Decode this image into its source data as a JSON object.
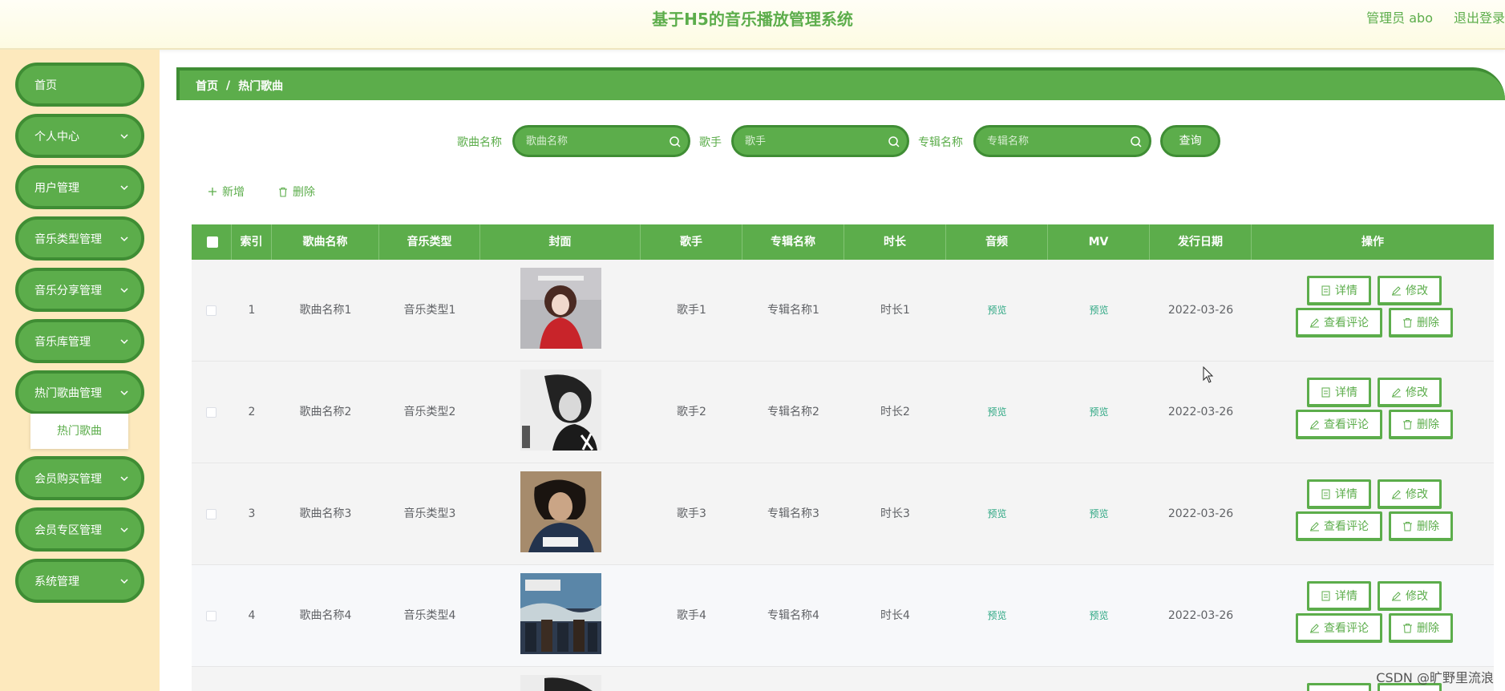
{
  "header": {
    "title": "基于H5的音乐播放管理系统",
    "user": "管理员 abo",
    "logout": "退出登录"
  },
  "sidebar": {
    "items": [
      {
        "label": "首页",
        "has_arrow": false
      },
      {
        "label": "个人中心",
        "has_arrow": true
      },
      {
        "label": "用户管理",
        "has_arrow": true
      },
      {
        "label": "音乐类型管理",
        "has_arrow": true
      },
      {
        "label": "音乐分享管理",
        "has_arrow": true
      },
      {
        "label": "音乐库管理",
        "has_arrow": true
      },
      {
        "label": "热门歌曲管理",
        "has_arrow": true
      },
      {
        "label": "会员购买管理",
        "has_arrow": true
      },
      {
        "label": "会员专区管理",
        "has_arrow": true
      },
      {
        "label": "系统管理",
        "has_arrow": true
      }
    ],
    "submenu": {
      "label": "热门歌曲"
    }
  },
  "breadcrumb": {
    "home": "首页",
    "sep": "/",
    "current": "热门歌曲"
  },
  "search": {
    "song_label": "歌曲名称",
    "song_placeholder": "歌曲名称",
    "singer_label": "歌手",
    "singer_placeholder": "歌手",
    "album_label": "专辑名称",
    "album_placeholder": "专辑名称",
    "query_label": "查询"
  },
  "actions": {
    "add_label": "新增",
    "delete_label": "删除"
  },
  "table": {
    "headers": [
      "索引",
      "歌曲名称",
      "音乐类型",
      "封面",
      "歌手",
      "专辑名称",
      "时长",
      "音频",
      "MV",
      "发行日期",
      "操作"
    ],
    "rows": [
      {
        "index": "1",
        "song": "歌曲名称1",
        "type": "音乐类型1",
        "singer": "歌手1",
        "album": "专辑名称1",
        "duration": "时长1",
        "audio": "预览",
        "mv": "预览",
        "date": "2022-03-26"
      },
      {
        "index": "2",
        "song": "歌曲名称2",
        "type": "音乐类型2",
        "singer": "歌手2",
        "album": "专辑名称2",
        "duration": "时长2",
        "audio": "预览",
        "mv": "预览",
        "date": "2022-03-26"
      },
      {
        "index": "3",
        "song": "歌曲名称3",
        "type": "音乐类型3",
        "singer": "歌手3",
        "album": "专辑名称3",
        "duration": "时长3",
        "audio": "预览",
        "mv": "预览",
        "date": "2022-03-26"
      },
      {
        "index": "4",
        "song": "歌曲名称4",
        "type": "音乐类型4",
        "singer": "歌手4",
        "album": "专辑名称4",
        "duration": "时长4",
        "audio": "预览",
        "mv": "预览",
        "date": "2022-03-26"
      }
    ],
    "row_actions": {
      "detail": "详情",
      "edit": "修改",
      "comments": "查看评论",
      "delete": "删除"
    }
  },
  "watermark": "CSDN @旷野里流浪",
  "colors": {
    "primary": "#5cad4b",
    "primary_dark": "#3f8d34",
    "sidebar_bg": "#fde9bd",
    "link": "#2ea783"
  }
}
